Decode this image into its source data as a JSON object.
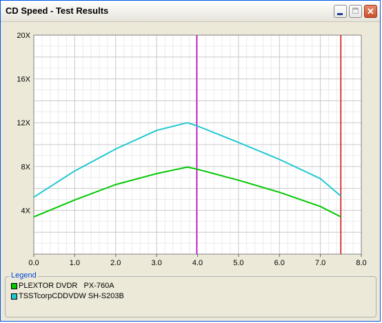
{
  "window": {
    "title": "CD Speed - Test Results"
  },
  "chart_data": {
    "type": "line",
    "xlim": [
      0,
      8
    ],
    "ylim": [
      0,
      20
    ],
    "x_ticks": [
      "0.0",
      "1.0",
      "2.0",
      "3.0",
      "4.0",
      "5.0",
      "6.0",
      "7.0",
      "8.0"
    ],
    "y_ticks": [
      "20X",
      "16X",
      "12X",
      "8X",
      "4X"
    ],
    "grid": true,
    "series": [
      {
        "name": "PLEXTOR DVDR   PX-760A",
        "color": "#00c800",
        "points": [
          [
            0.0,
            3.4
          ],
          [
            1.0,
            4.95
          ],
          [
            2.0,
            6.35
          ],
          [
            3.0,
            7.35
          ],
          [
            3.75,
            7.95
          ],
          [
            4.0,
            7.75
          ],
          [
            5.0,
            6.75
          ],
          [
            6.0,
            5.65
          ],
          [
            7.0,
            4.35
          ],
          [
            7.5,
            3.4
          ]
        ]
      },
      {
        "name": "TSSTcorpCDDVDW SH-S203B",
        "color": "#1ec8d2",
        "points": [
          [
            0.0,
            5.2
          ],
          [
            1.0,
            7.6
          ],
          [
            2.0,
            9.6
          ],
          [
            3.0,
            11.3
          ],
          [
            3.75,
            12.0
          ],
          [
            4.0,
            11.7
          ],
          [
            5.0,
            10.2
          ],
          [
            6.0,
            8.65
          ],
          [
            7.0,
            6.9
          ],
          [
            7.5,
            5.3
          ]
        ]
      }
    ],
    "markers": [
      {
        "x": 3.98,
        "color": "#cc00cc"
      },
      {
        "x": 7.5,
        "color": "#cc0000"
      }
    ]
  },
  "legend": {
    "title": "Legend",
    "items": [
      {
        "label": "PLEXTOR DVDR   PX-760A",
        "color": "#00c800"
      },
      {
        "label": "TSSTcorpCDDVDW SH-S203B",
        "color": "#1ec8d2"
      }
    ]
  }
}
